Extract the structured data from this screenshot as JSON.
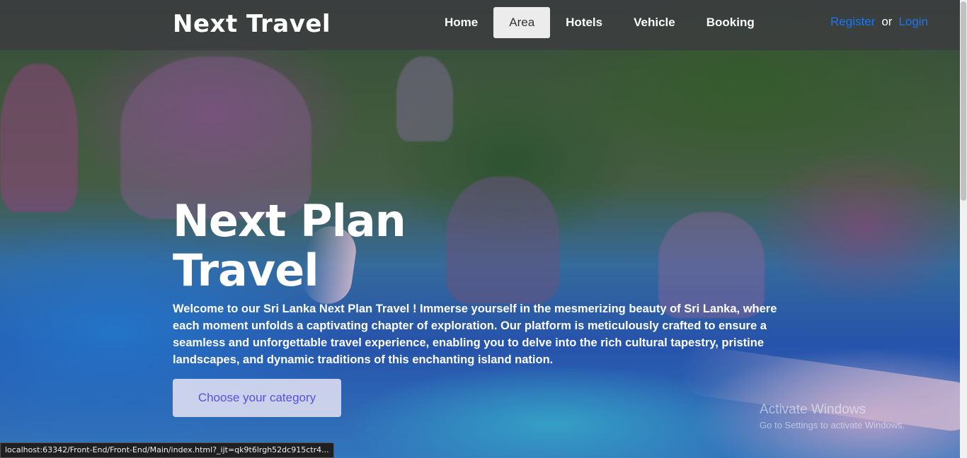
{
  "nav": {
    "brand": "Next Travel",
    "items": [
      {
        "label": "Home",
        "active": false
      },
      {
        "label": "Area",
        "active": true
      },
      {
        "label": "Hotels",
        "active": false
      },
      {
        "label": "Vehicle",
        "active": false
      },
      {
        "label": "Booking",
        "active": false
      }
    ],
    "register_label": "Register",
    "or_label": "or",
    "login_label": "Login"
  },
  "hero": {
    "headline_line1": "Next Plan",
    "headline_line2": "Travel",
    "intro": "Welcome to our Sri Lanka Next Plan Travel ! Immerse yourself in the mesmerizing beauty of Sri Lanka, where each moment unfolds a captivating chapter of exploration. Our platform is meticulously crafted to ensure a seamless and unforgettable travel experience, enabling you to delve into the rich cultural tapestry, pristine landscapes, and dynamic traditions of this enchanting island nation.",
    "cta_label": "Choose your category"
  },
  "watermark": {
    "title": "Activate Windows",
    "subtitle": "Go to Settings to activate Windows."
  },
  "status_url": "localhost:63342/Front-End/Front-End/Main/index.html?_ijt=qk9t6lrgh52dc915ctr4...",
  "colors": {
    "nav_bg": "#3c3c40",
    "link_blue": "#1877f2",
    "cta_text": "#5552d6",
    "active_tab_bg": "#ececec"
  }
}
